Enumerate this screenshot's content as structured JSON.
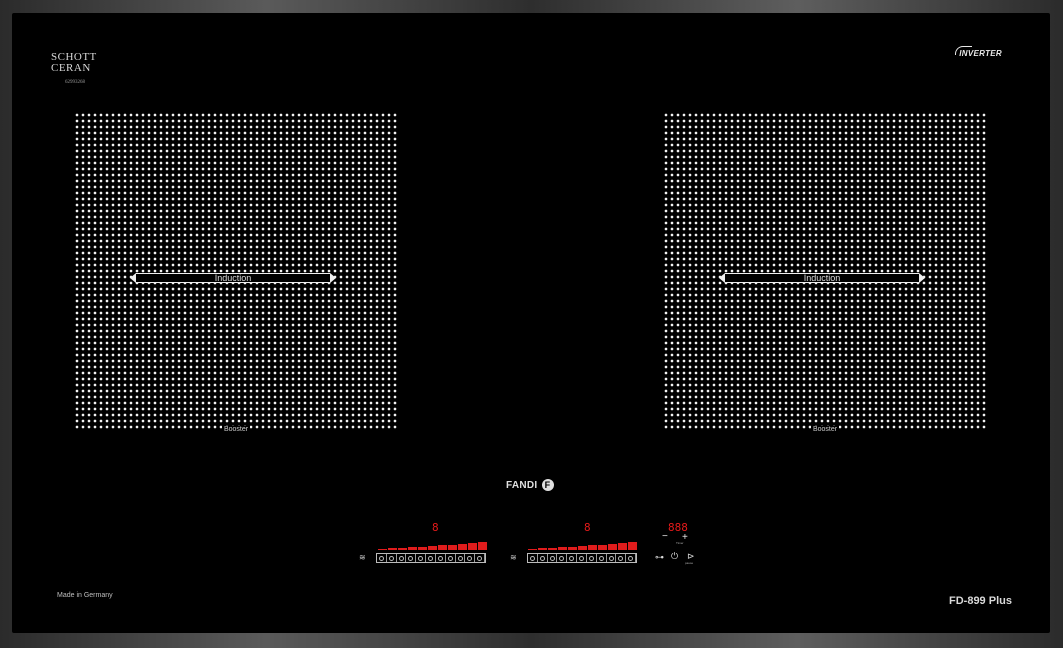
{
  "brand": {
    "glass_line1": "SCHOTT",
    "glass_line2": "CERAN",
    "glass_code": "62993268",
    "inverter": "INVERTER",
    "maker": "FANDI",
    "maker_mark": "F"
  },
  "zones": [
    {
      "label": "Induction",
      "booster": "Booster"
    },
    {
      "label": "Induction",
      "booster": "Booster"
    }
  ],
  "controls": {
    "zone1_display": "8",
    "zone2_display": "8",
    "timer_display": "888",
    "timer_minus": "−",
    "timer_plus": "+",
    "timer_label": "Timer",
    "heat_icon": "≋",
    "lock_icon": "⊶",
    "power_icon": "⏻",
    "pause_icon": "⊳",
    "pause_label": "pause",
    "slider_levels": 11
  },
  "footer": {
    "made_in": "Made in Germany",
    "model": "FD-899 Plus"
  },
  "colors": {
    "glass": "#000000",
    "display_red": "#e41a1a",
    "frame": "#4a4a4a"
  }
}
